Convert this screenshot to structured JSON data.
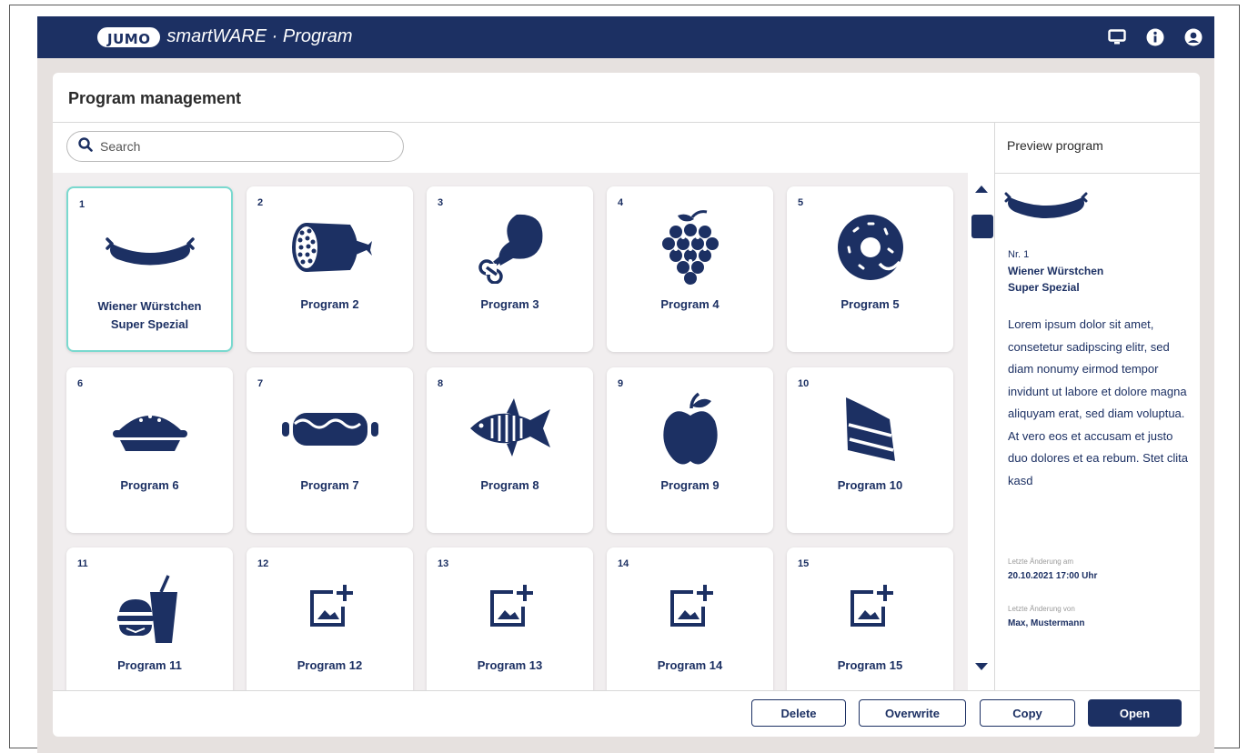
{
  "app": {
    "logo_brand": "JUMO",
    "logo_product": "smartWARE · Program",
    "top_icons": [
      "monitor-icon",
      "info-icon",
      "user-icon"
    ]
  },
  "page": {
    "title": "Program management",
    "search_placeholder": "Search"
  },
  "programs": [
    {
      "num": "1",
      "label": "Wiener Würstchen\nSuper Spezial",
      "icon": "sausage-icon",
      "selected": true
    },
    {
      "num": "2",
      "label": "Program   2",
      "icon": "salami-icon"
    },
    {
      "num": "3",
      "label": "Program   3",
      "icon": "chicken-leg-icon"
    },
    {
      "num": "4",
      "label": "Program   4",
      "icon": "grapes-icon"
    },
    {
      "num": "5",
      "label": "Program   5",
      "icon": "donut-icon"
    },
    {
      "num": "6",
      "label": "Program   6",
      "icon": "pie-icon"
    },
    {
      "num": "7",
      "label": "Program   7",
      "icon": "hotdog-icon"
    },
    {
      "num": "8",
      "label": "Program   8",
      "icon": "fish-icon"
    },
    {
      "num": "9",
      "label": "Program   9",
      "icon": "apple-icon"
    },
    {
      "num": "10",
      "label": "Program   10",
      "icon": "cake-icon"
    },
    {
      "num": "11",
      "label": "Program   11",
      "icon": "fastfood-icon"
    },
    {
      "num": "12",
      "label": "Program   12",
      "icon": "add-image-icon"
    },
    {
      "num": "13",
      "label": "Program   13",
      "icon": "add-image-icon"
    },
    {
      "num": "14",
      "label": "Program   14",
      "icon": "add-image-icon"
    },
    {
      "num": "15",
      "label": "Program   15",
      "icon": "add-image-icon"
    }
  ],
  "preview": {
    "header": "Preview program",
    "nr": "Nr. 1",
    "name": "Wiener Würstchen\nSuper Spezial",
    "description": "Lorem ipsum dolor sit amet, consetetur sadipscing elitr, sed diam nonumy eirmod tempor invidunt ut labore et dolore magna aliquyam erat, sed diam voluptua. At vero eos et accusam et justo duo dolores et ea rebum. Stet clita kasd",
    "changed_at_label": "Letzte Änderung am",
    "changed_at_value": "20.10.2021  17:00 Uhr",
    "changed_by_label": "Letzte Änderung von",
    "changed_by_value": "Max, Mustermann"
  },
  "buttons": {
    "delete": "Delete",
    "overwrite": "Overwrite",
    "copy": "Copy",
    "open": "Open"
  },
  "colors": {
    "brand": "#1c3063",
    "selected_border": "#7ad9cf"
  }
}
